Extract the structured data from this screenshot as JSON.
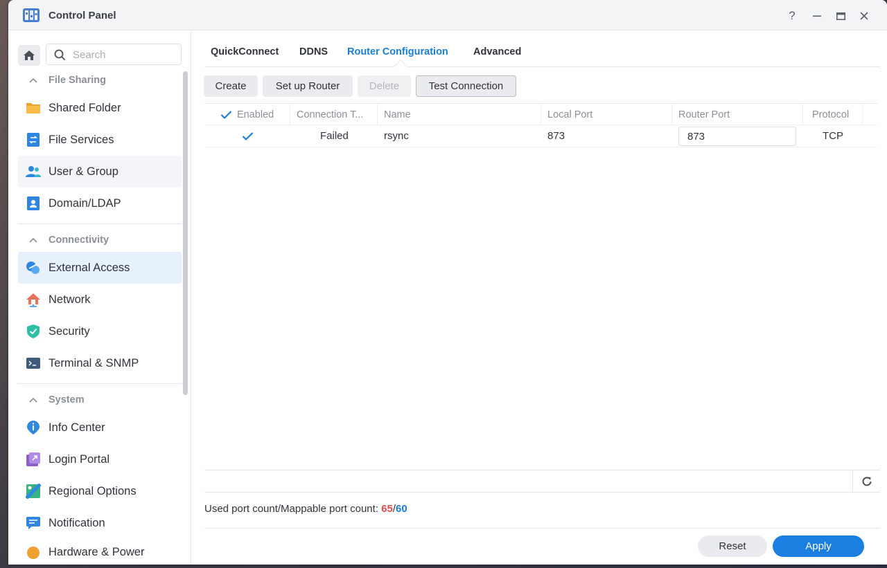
{
  "window": {
    "title": "Control Panel",
    "controls": {
      "help": "?",
      "minimize": "—",
      "maximize": "▭",
      "close": "✕"
    }
  },
  "sidebar": {
    "search_placeholder": "Search",
    "sections": [
      {
        "label": "File Sharing",
        "items": [
          "Shared Folder",
          "File Services",
          "User & Group",
          "Domain/LDAP"
        ]
      },
      {
        "label": "Connectivity",
        "items": [
          "External Access",
          "Network",
          "Security",
          "Terminal & SNMP"
        ]
      },
      {
        "label": "System",
        "items": [
          "Info Center",
          "Login Portal",
          "Regional Options",
          "Notification",
          "Hardware & Power"
        ]
      }
    ],
    "active_item": "External Access"
  },
  "tabs": [
    "QuickConnect",
    "DDNS",
    "Router Configuration",
    "Advanced"
  ],
  "active_tab": "Router Configuration",
  "toolbar": {
    "create": "Create",
    "setup_router": "Set up Router",
    "delete": "Delete",
    "test_connection": "Test Connection"
  },
  "table": {
    "columns": [
      "Enabled",
      "Connection T...",
      "Name",
      "Local Port",
      "Router Port",
      "Protocol"
    ],
    "rows": [
      {
        "enabled": true,
        "connection": "Failed",
        "name": "rsync",
        "local_port": "873",
        "router_port": "873",
        "protocol": "TCP"
      }
    ]
  },
  "port_count": {
    "label": "Used port count/Mappable port count: ",
    "used": "65",
    "separator": "/",
    "mappable": "60"
  },
  "footer": {
    "reset": "Reset",
    "apply": "Apply"
  },
  "colors": {
    "accent": "#1a7fd4",
    "danger": "#e34a4a",
    "active_bg": "#e7f1fc"
  }
}
